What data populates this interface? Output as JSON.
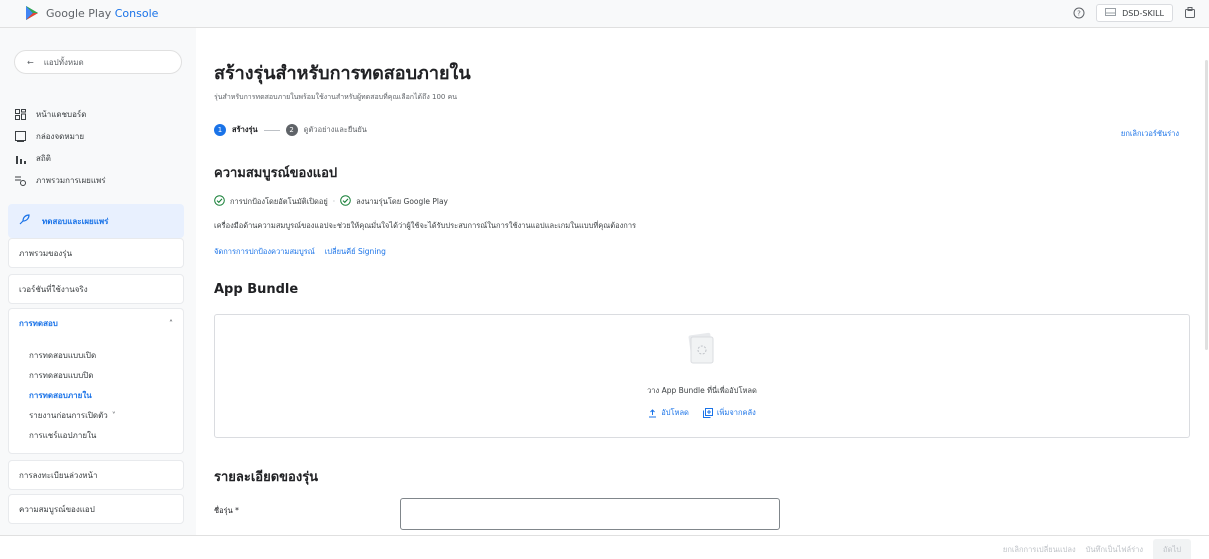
{
  "app": {
    "brand_google_play": "Google Play",
    "brand_console": "Console"
  },
  "topbar": {
    "account_name": "DSD-SKILL"
  },
  "sidebar": {
    "back_label": "แอปทั้งหมด",
    "nav": [
      "หน้าแดชบอร์ด",
      "กล่องจดหมาย",
      "สถิติ",
      "ภาพรวมการเผยแพร่"
    ],
    "section_title": "ทดสอบและเผยแพร่",
    "release_overview": "ภาพรวมของรุ่น",
    "production": "เวอร์ชันที่ใช้งานจริง",
    "testing": "การทดสอบ",
    "testing_items": [
      "การทดสอบแบบเปิด",
      "การทดสอบแบบปิด",
      "การทดสอบภายใน",
      "รายงานก่อนการเปิดตัว",
      "การแชร์แอปภายใน"
    ],
    "preregistration": "การลงทะเบียนล่วงหน้า",
    "app_integrity": "ความสมบูรณ์ของแอป"
  },
  "page": {
    "title": "สร้างรุ่นสำหรับการทดสอบภายใน",
    "subtitle": "รุ่นสำหรับการทดสอบภายในพร้อมใช้งานสำหรับผู้ทดสอบที่คุณเลือกได้ถึง 100 คน",
    "step1_num": "1",
    "step1_label": "สร้างรุ่น",
    "step2_num": "2",
    "step2_label": "ดูตัวอย่างและยืนยัน",
    "discard_draft": "ยกเลิกเวอร์ชันร่าง",
    "integrity_heading": "ความสมบูรณ์ของแอป",
    "integrity_status_1": "การปกป้องโดยอัตโนมัติเปิดอยู่",
    "integrity_separator": "·",
    "integrity_status_2": "ลงนามรุ่นโดย Google Play",
    "integrity_desc": "เครื่องมือด้านความสมบูรณ์ของแอปจะช่วยให้คุณมั่นใจได้ว่าผู้ใช้จะได้รับประสบการณ์ในการใช้งานแอปและเกมในแบบที่คุณต้องการ",
    "link_manage_integrity": "จัดการการปกป้องความสมบูรณ์",
    "link_change_signing": "เปลี่ยนคีย์ Signing",
    "bundle_heading": "App Bundle",
    "bundle_drop": "วาง App Bundle ที่นี่เพื่ออัปโหลด",
    "bundle_upload": "อัปโหลด",
    "bundle_add_library": "เพิ่มจากคลัง",
    "release_details_heading": "รายละเอียดของรุ่น",
    "release_name_label": "ชื่อรุ่น *"
  },
  "footer": {
    "discard_changes": "ยกเลิกการเปลี่ยนแปลง",
    "save_draft": "บันทึกเป็นไฟล์ร่าง",
    "next": "ถัดไป"
  }
}
